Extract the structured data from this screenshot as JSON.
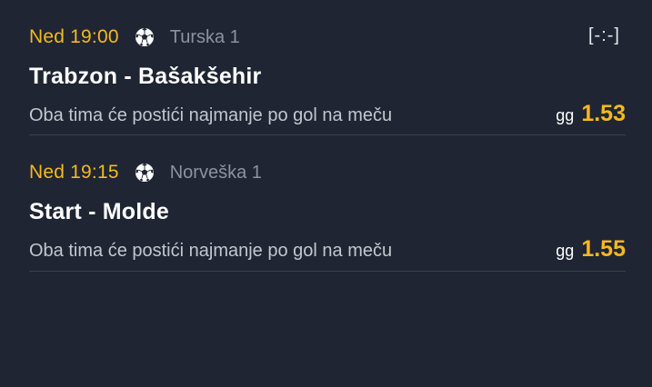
{
  "matches": [
    {
      "time": "Ned 19:00",
      "sport_icon": "soccer-ball-icon",
      "league": "Turska 1",
      "score": "[-:-]",
      "teams": "Trabzon - Bašakšehir",
      "market": "Oba tima će postići najmanje po gol na meču",
      "pick": "gg",
      "odd": "1.53"
    },
    {
      "time": "Ned 19:15",
      "sport_icon": "soccer-ball-icon",
      "league": "Norveška 1",
      "teams": "Start - Molde",
      "market": "Oba tima će postići najmanje po gol na meču",
      "pick": "gg",
      "odd": "1.55"
    }
  ],
  "colors": {
    "background": "#1f2532",
    "accent": "#f5b91e",
    "divider": "#3a4150"
  }
}
